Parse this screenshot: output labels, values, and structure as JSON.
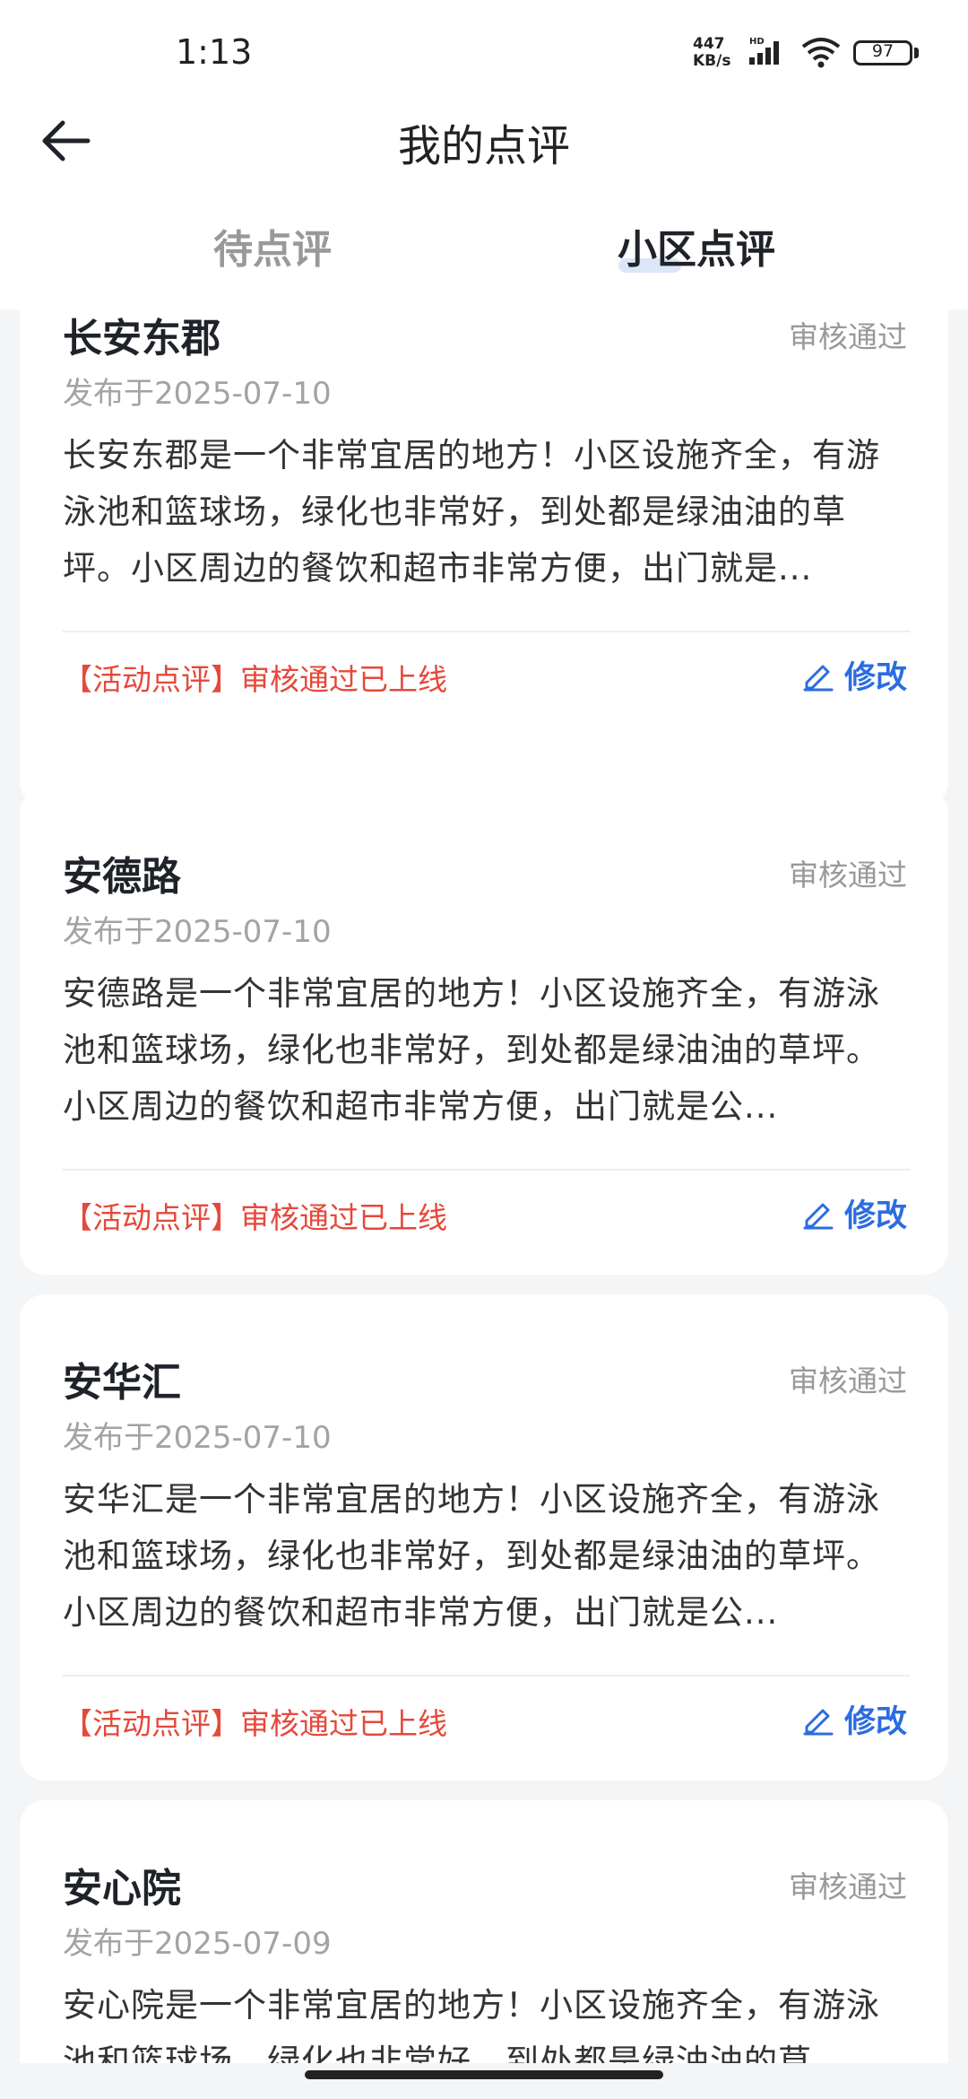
{
  "status_bar": {
    "time": "1:13",
    "net_speed_value": "447",
    "net_speed_unit": "KB/s",
    "network_badge": "HD",
    "battery": "97"
  },
  "header": {
    "title": "我的点评"
  },
  "tabs": [
    {
      "label": "待点评",
      "active": false
    },
    {
      "label": "小区点评",
      "active": true
    }
  ],
  "reviews": [
    {
      "name": "长安东郡",
      "status": "审核通过",
      "date": "发布于2025-07-10",
      "body": "长安东郡是一个非常宜居的地方！小区设施齐全，有游泳池和篮球场，绿化也非常好，到处都是绿油油的草坪。小区周边的餐饮和超市非常方便，出门就是...",
      "note": "【活动点评】审核通过已上线",
      "edit_label": "修改"
    },
    {
      "name": "安德路",
      "status": "审核通过",
      "date": "发布于2025-07-10",
      "body": "安德路是一个非常宜居的地方！小区设施齐全，有游泳池和篮球场，绿化也非常好，到处都是绿油油的草坪。小区周边的餐饮和超市非常方便，出门就是公...",
      "note": "【活动点评】审核通过已上线",
      "edit_label": "修改"
    },
    {
      "name": "安华汇",
      "status": "审核通过",
      "date": "发布于2025-07-10",
      "body": "安华汇是一个非常宜居的地方！小区设施齐全，有游泳池和篮球场，绿化也非常好，到处都是绿油油的草坪。小区周边的餐饮和超市非常方便，出门就是公...",
      "note": "【活动点评】审核通过已上线",
      "edit_label": "修改"
    },
    {
      "name": "安心院",
      "status": "审核通过",
      "date": "发布于2025-07-09",
      "body": "安心院是一个非常宜居的地方！小区设施齐全，有游泳池和篮球场，绿化也非常好，到处都是绿油油的草",
      "note": "",
      "edit_label": ""
    }
  ],
  "colors": {
    "accent": "#2b6de0",
    "note_red": "#e6483a",
    "muted": "#999999",
    "background": "#f4f5f7"
  }
}
